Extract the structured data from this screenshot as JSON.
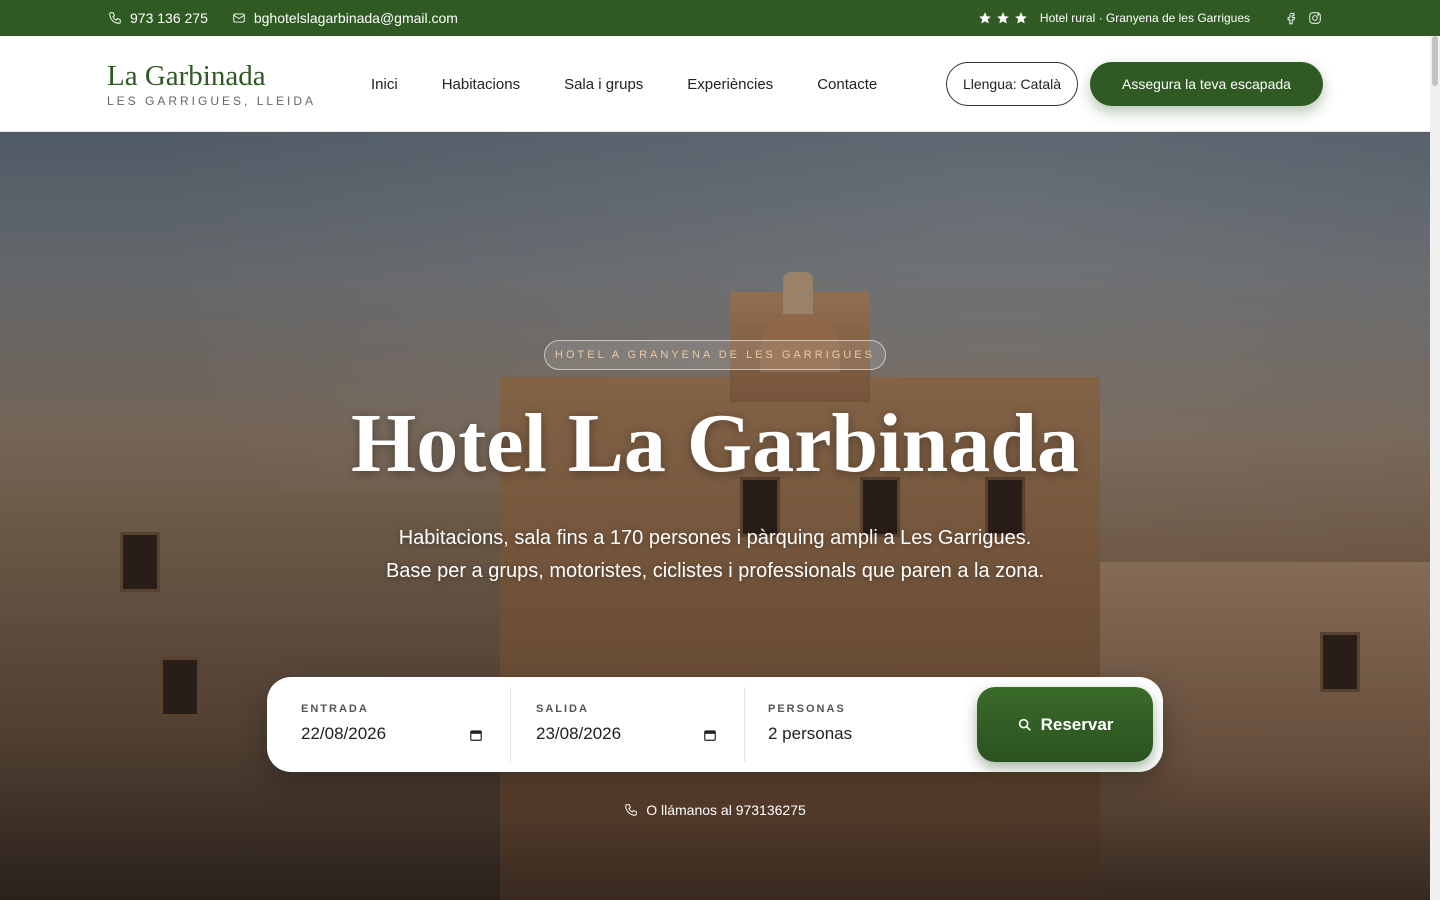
{
  "topbar": {
    "phone": "973 136 275",
    "email": "bghotelslagarbinada@gmail.com",
    "rating_stars": 3,
    "category": "Hotel rural · Granyena de les Garrigues",
    "social": [
      "facebook-icon",
      "instagram-icon"
    ]
  },
  "header": {
    "brand_name": "La Garbinada",
    "brand_sub": "LES GARRIGUES, LLEIDA",
    "nav": [
      "Inici",
      "Habitacions",
      "Sala i grups",
      "Experiències",
      "Contacte"
    ],
    "language_button": "Llengua: Català",
    "cta_button": "Assegura la teva escapada"
  },
  "hero": {
    "badge": "HOTEL A GRANYENA DE LES GARRIGUES",
    "title": "Hotel La Garbinada",
    "subtitle": "Habitacions, sala fins a 170 persones i pàrquing ampli a Les Garrigues. Base per a grups, motoristes, ciclistes i professionals que paren a la zona.",
    "call_note": "O llámanos al 973136275"
  },
  "booking": {
    "checkin_label": "ENTRADA",
    "checkin_value": "22/08/2026",
    "checkout_label": "SALIDA",
    "checkout_value": "23/08/2026",
    "guests_label": "PERSONAS",
    "guests_value": "2 personas",
    "submit_label": "Reservar"
  },
  "colors": {
    "brand_green": "#2f5a23",
    "badge_text": "#e9c9a3"
  }
}
